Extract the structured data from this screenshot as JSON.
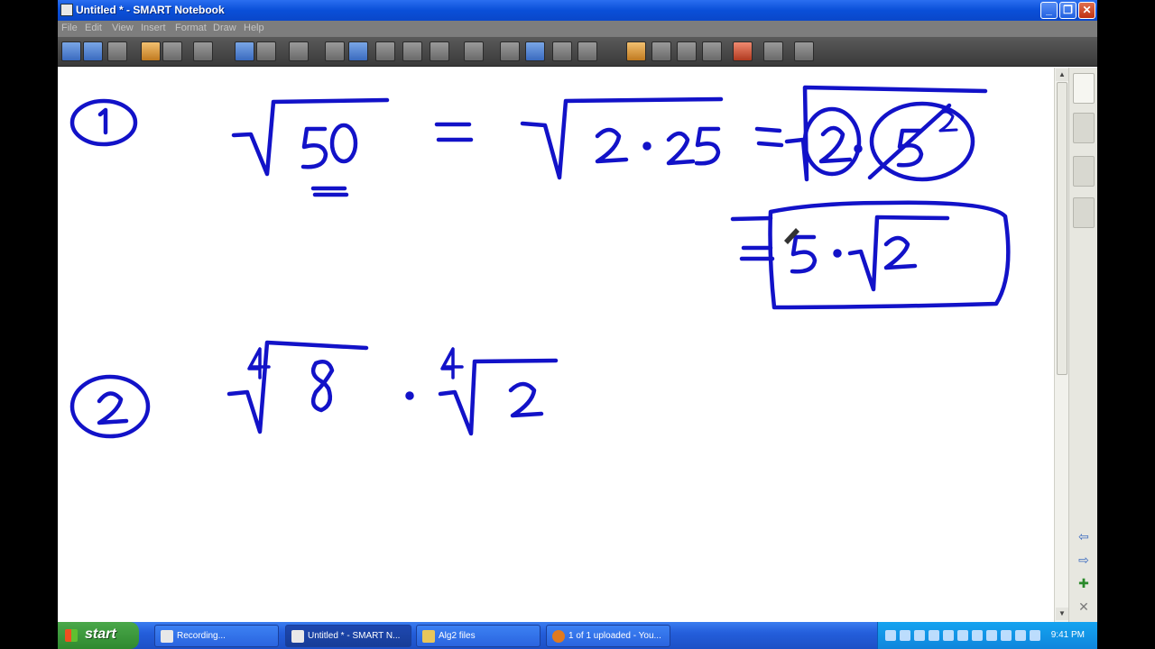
{
  "window": {
    "title": "Untitled * - SMART Notebook",
    "menu": [
      "File",
      "Edit",
      "View",
      "Insert",
      "Format",
      "Draw",
      "Help"
    ]
  },
  "controls": {
    "minimize": "_",
    "maximize": "❐",
    "close": "✕"
  },
  "taskbar": {
    "start_label": "start",
    "tasks": [
      {
        "label": "Recording...",
        "icon": "recorder-icon"
      },
      {
        "label": "Untitled * - SMART N...",
        "icon": "notebook-icon"
      },
      {
        "label": "Alg2 files",
        "icon": "folder-icon"
      },
      {
        "label": "1 of 1 uploaded - You...",
        "icon": "firefox-icon"
      }
    ],
    "clock": "9:41 PM"
  },
  "colors": {
    "ink": "#1212c8",
    "titlebar": "#0a4fd8",
    "taskbar": "#245edb"
  }
}
